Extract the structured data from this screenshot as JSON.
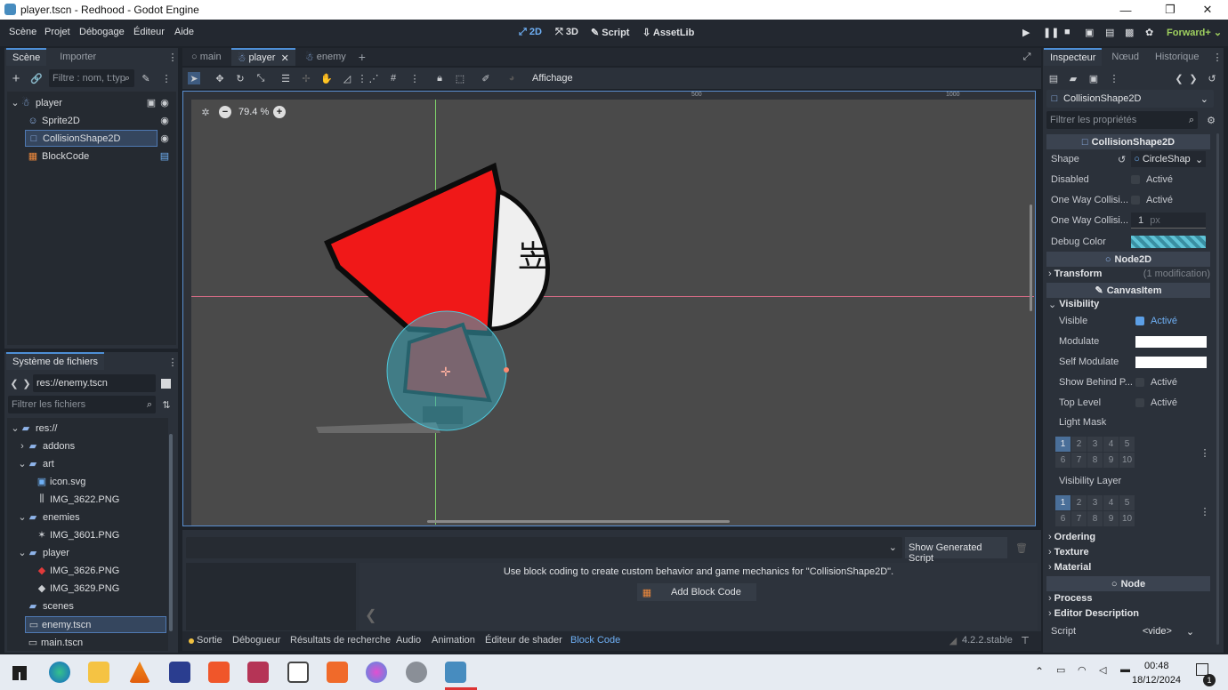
{
  "window": {
    "title": "player.tscn - Redhood - Godot Engine"
  },
  "menu": {
    "items": [
      "Scène",
      "Projet",
      "Débogage",
      "Éditeur",
      "Aide"
    ],
    "workspaces": [
      "2D",
      "3D",
      "Script",
      "AssetLib"
    ],
    "renderer": "Forward+"
  },
  "scene_dock": {
    "tabs": [
      "Scène",
      "Importer"
    ],
    "filter_placeholder": "Filtre : nom, t:typ",
    "nodes": [
      {
        "name": "player"
      },
      {
        "name": "Sprite2D"
      },
      {
        "name": "CollisionShape2D"
      },
      {
        "name": "BlockCode"
      }
    ]
  },
  "filesystem": {
    "title": "Système de fichiers",
    "path": "res://enemy.tscn",
    "filter_placeholder": "Filtrer les fichiers",
    "items": [
      {
        "name": "res://"
      },
      {
        "name": "addons"
      },
      {
        "name": "art"
      },
      {
        "name": "icon.svg"
      },
      {
        "name": "IMG_3622.PNG"
      },
      {
        "name": "enemies"
      },
      {
        "name": "IMG_3601.PNG"
      },
      {
        "name": "player"
      },
      {
        "name": "IMG_3626.PNG"
      },
      {
        "name": "IMG_3629.PNG"
      },
      {
        "name": "scenes"
      },
      {
        "name": "enemy.tscn"
      },
      {
        "name": "main.tscn"
      }
    ]
  },
  "editor": {
    "tabs": [
      "main",
      "player",
      "enemy"
    ],
    "toolbar_view": "Affichage",
    "zoom": "79.4 %",
    "ruler": [
      "500",
      "1000"
    ]
  },
  "block_code": {
    "show_script": "Show Generated Script",
    "message": "Use block coding to create custom behavior and game mechanics for \"CollisionShape2D\".",
    "add_label": "Add Block Code"
  },
  "bottom_tabs": [
    "Sortie",
    "Débogueur",
    "Résultats de recherche",
    "Audio",
    "Animation",
    "Éditeur de shader",
    "Block Code"
  ],
  "version": "4.2.2.stable",
  "inspector": {
    "tabs": [
      "Inspecteur",
      "Nœud",
      "Historique"
    ],
    "node": "CollisionShape2D",
    "filter_placeholder": "Filtrer les propriétés",
    "section_collision": "CollisionShape2D",
    "shape_label": "Shape",
    "shape_value": "CircleShap",
    "disabled_label": "Disabled",
    "oneway_label": "One Way Collisi...",
    "oneway_margin_label": "One Way Collisi...",
    "oneway_margin_value": "1",
    "oneway_unit": "px",
    "debug_color_label": "Debug Color",
    "active": "Activé",
    "section_node2d": "Node2D",
    "transform": "Transform",
    "transform_mod": "(1 modification)",
    "section_canvas": "CanvasItem",
    "visibility": "Visibility",
    "visible_label": "Visible",
    "modulate_label": "Modulate",
    "self_modulate_label": "Self Modulate",
    "show_behind_label": "Show Behind P...",
    "top_level_label": "Top Level",
    "light_mask_label": "Light Mask",
    "visibility_layer_label": "Visibility Layer",
    "layers": [
      "1",
      "2",
      "3",
      "4",
      "5",
      "6",
      "7",
      "8",
      "9",
      "10"
    ],
    "ordering": "Ordering",
    "texture": "Texture",
    "material": "Material",
    "section_node": "Node",
    "process": "Process",
    "editor_desc": "Editor Description",
    "script_label": "Script",
    "script_value": "<vide>"
  },
  "taskbar": {
    "time": "00:48",
    "date": "18/12/2024",
    "notif": "1"
  }
}
